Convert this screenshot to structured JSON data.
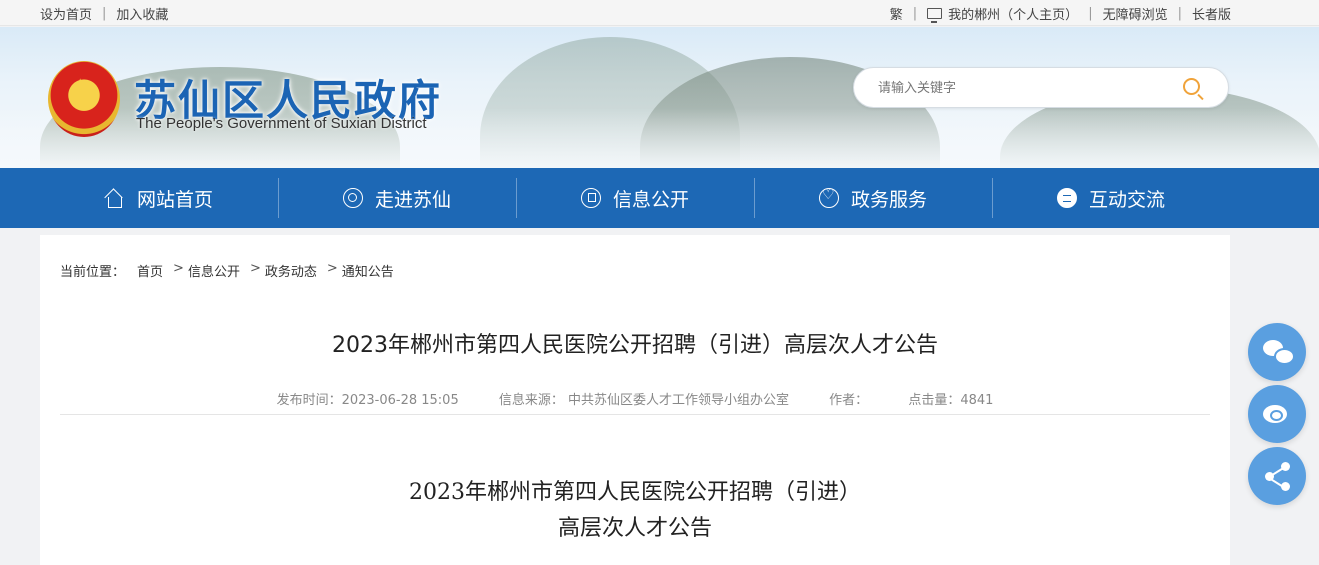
{
  "topbar": {
    "left_links": [
      "设为首页",
      "加入收藏"
    ],
    "right_links": [
      "繁",
      "我的郴州（个人主页）",
      "无障碍浏览",
      "长者版"
    ]
  },
  "header": {
    "title": "苏仙区人民政府",
    "subtitle": "The People's Government of Suxian District",
    "search_placeholder": "请输入关键字"
  },
  "nav": {
    "items": [
      {
        "label": "网站首页",
        "icon": "home-icon"
      },
      {
        "label": "走进苏仙",
        "icon": "target-icon"
      },
      {
        "label": "信息公开",
        "icon": "flag-icon"
      },
      {
        "label": "政务服务",
        "icon": "heart-icon"
      },
      {
        "label": "互动交流",
        "icon": "chat-icon"
      }
    ]
  },
  "breadcrumb": {
    "prefix": "当前位置：",
    "items": [
      "首页",
      "信息公开",
      "政务动态",
      "通知公告"
    ]
  },
  "article": {
    "title": "2023年郴州市第四人民医院公开招聘（引进）高层次人才公告",
    "publish_time": "发布时间：2023-06-28 15:05",
    "source": "信息来源：  中共苏仙区委人才工作领导小组办公室",
    "author": "作者：",
    "views": "点击量：4841",
    "body_title_line1": "2023年郴州市第四人民医院公开招聘（引进）",
    "body_title_line2": "高层次人才公告"
  },
  "share": {
    "buttons": [
      "wechat-icon",
      "weibo-icon",
      "share-icon"
    ]
  },
  "colors": {
    "nav_bg": "#1d68b5",
    "title_blue": "#1b64b4",
    "share_btn": "#5a9fe0",
    "search_accent": "#f0a33a"
  }
}
